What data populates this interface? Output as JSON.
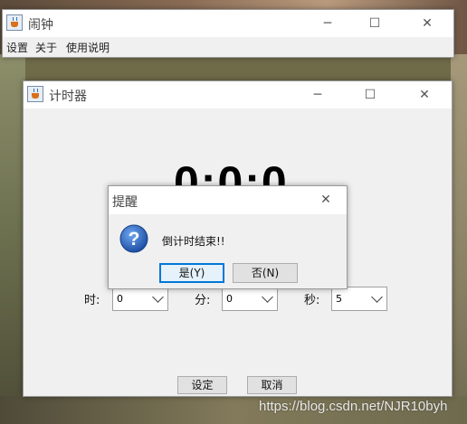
{
  "alarm_window": {
    "title": "闹钟",
    "menu": [
      "设置",
      "关于",
      "使用说明"
    ]
  },
  "timer_window": {
    "title": "计时器",
    "clock_display": "0:0:0",
    "hour_label": "时:",
    "minute_label": "分:",
    "second_label": "秒:",
    "hour_value": "0",
    "minute_value": "0",
    "second_value": "5",
    "set_button": "设定",
    "cancel_button": "取消"
  },
  "dialog": {
    "title": "提醒",
    "message": "倒计时结束!!",
    "yes_button": "是(Y)",
    "no_button": "否(N)"
  },
  "watermark": "https://blog.csdn.net/NJR10byh",
  "window_controls": {
    "minimize": "─",
    "maximize": "☐",
    "close": "✕"
  }
}
